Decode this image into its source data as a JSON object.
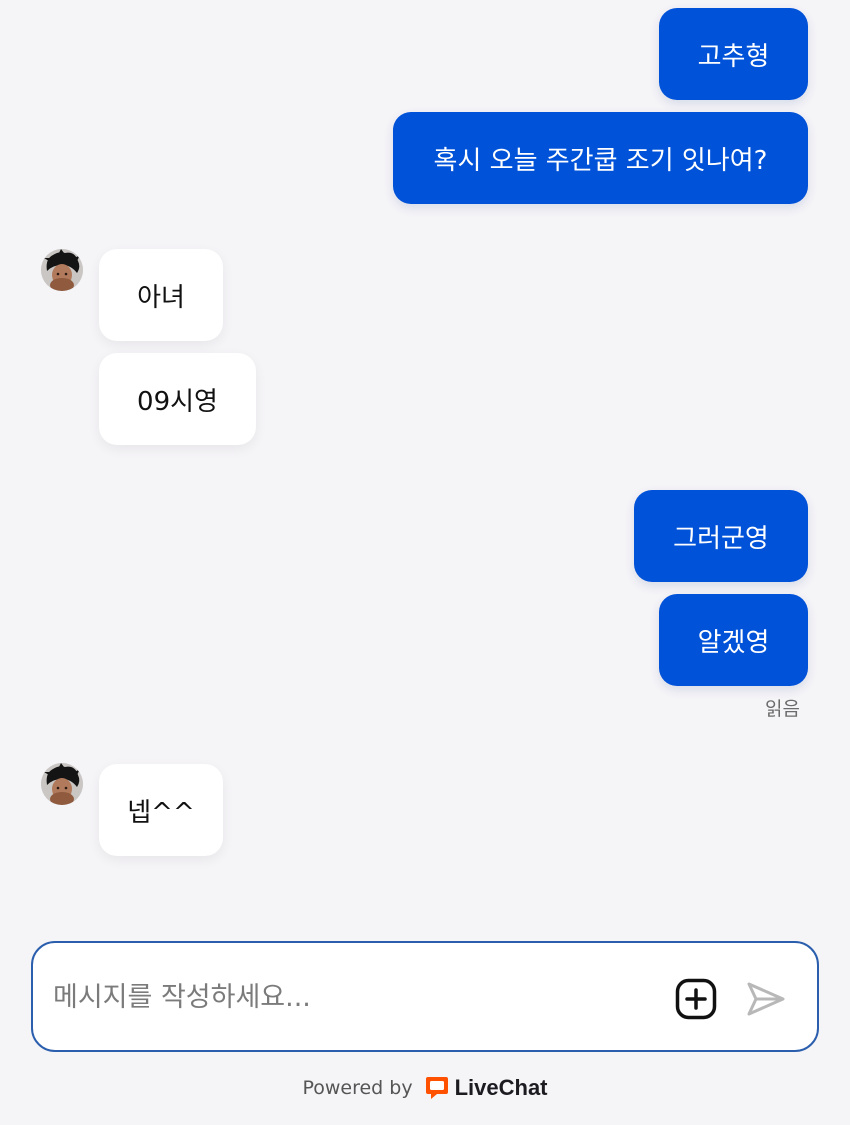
{
  "messages": [
    {
      "text": "고추형"
    },
    {
      "text": "혹시 오늘 주간쿱 조기 잇나여?"
    },
    {
      "text": "아녀"
    },
    {
      "text": "09시영"
    },
    {
      "text": "그러군영"
    },
    {
      "text": "알겠영"
    },
    {
      "text": "넵^^"
    }
  ],
  "read_status": "읽음",
  "composer": {
    "placeholder": "메시지를 작성하세요..."
  },
  "footer": {
    "powered_by": "Powered by",
    "brand": "LiveChat"
  },
  "colors": {
    "outgoing_bubble": "#0052d9",
    "incoming_bubble": "#ffffff",
    "background": "#f5f4f7",
    "brand_accent": "#ff5100",
    "composer_border": "#2b5fad"
  },
  "icons": {
    "attach": "plus-square-icon",
    "send": "send-icon",
    "brand_logo": "livechat-logo-icon"
  }
}
